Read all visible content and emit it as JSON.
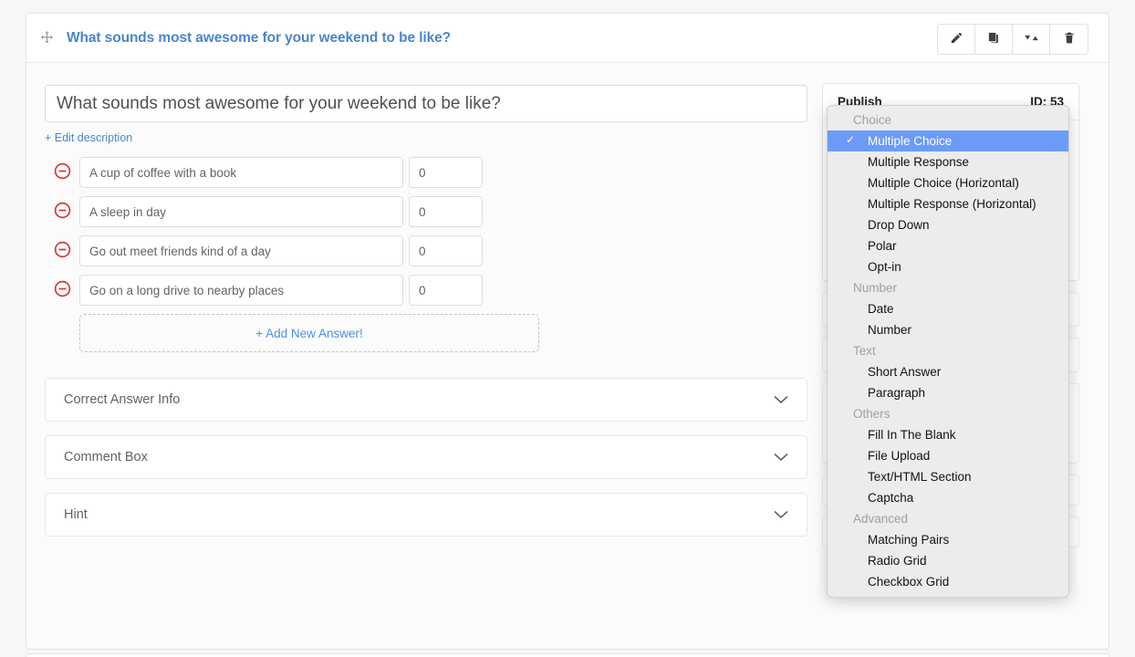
{
  "header": {
    "title": "What sounds most awesome for your weekend to be like?",
    "drag_icon": "move-arrows-icon",
    "actions": [
      {
        "name": "edit-button",
        "icon": "pencil-icon"
      },
      {
        "name": "duplicate-button",
        "icon": "copy-icon"
      },
      {
        "name": "reorder-button",
        "icon": "sort-arrows-icon"
      },
      {
        "name": "delete-button",
        "icon": "trash-icon"
      }
    ]
  },
  "question": {
    "title_value": "What sounds most awesome for your weekend to be like?",
    "title_placeholder": "Question title",
    "edit_description_label": "+ Edit description",
    "answers": [
      {
        "text": "A cup of coffee with a book",
        "score": "0"
      },
      {
        "text": "A sleep in day",
        "score": "0"
      },
      {
        "text": "Go out meet friends kind of a day",
        "score": "0"
      },
      {
        "text": "Go on a long drive to nearby places",
        "score": "0"
      }
    ],
    "add_answer_label": "+ Add New Answer!",
    "sections": [
      {
        "label": "Correct Answer Info",
        "chevron": "chevron-down-icon"
      },
      {
        "label": "Comment Box",
        "chevron": "chevron-down-icon"
      },
      {
        "label": "Hint",
        "chevron": "chevron-down-icon"
      }
    ]
  },
  "settings": {
    "publish_label": "Publish",
    "id_label": "ID: 53"
  },
  "dropdown": {
    "selected": "Multiple Choice",
    "check_glyph": "✓",
    "highlight_color": "#6b9bf7",
    "groups": [
      {
        "label": "Choice",
        "items": [
          "Multiple Choice",
          "Multiple Response",
          "Multiple Choice (Horizontal)",
          "Multiple Response (Horizontal)",
          "Drop Down",
          "Polar",
          "Opt-in"
        ]
      },
      {
        "label": "Number",
        "items": [
          "Date",
          "Number"
        ]
      },
      {
        "label": "Text",
        "items": [
          "Short Answer",
          "Paragraph"
        ]
      },
      {
        "label": "Others",
        "items": [
          "Fill In The Blank",
          "File Upload",
          "Text/HTML Section",
          "Captcha"
        ]
      },
      {
        "label": "Advanced",
        "items": [
          "Matching Pairs",
          "Radio Grid",
          "Checkbox Grid"
        ]
      }
    ]
  },
  "colors": {
    "accent_blue": "#4a86c8",
    "link_blue": "#4a90e8",
    "remove_red": "#cf3c38",
    "primary_button": "#3571b5"
  }
}
